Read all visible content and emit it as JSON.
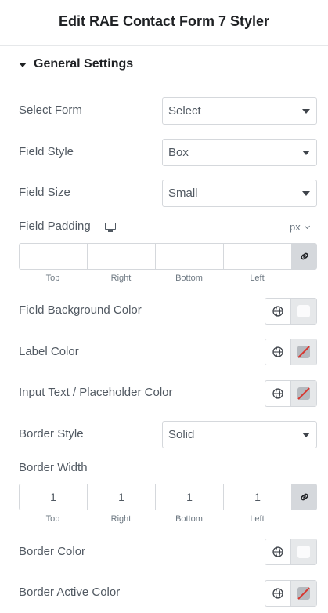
{
  "header": {
    "title": "Edit RAE Contact Form 7 Styler"
  },
  "section": {
    "title": "General Settings"
  },
  "select_form": {
    "label": "Select Form",
    "value": "Select"
  },
  "field_style": {
    "label": "Field Style",
    "value": "Box"
  },
  "field_size": {
    "label": "Field Size",
    "value": "Small"
  },
  "field_padding": {
    "label": "Field Padding",
    "unit": "px",
    "values": [
      "",
      "",
      "",
      ""
    ],
    "sides": [
      "Top",
      "Right",
      "Bottom",
      "Left"
    ]
  },
  "field_bg_color": {
    "label": "Field Background Color",
    "state": "white"
  },
  "label_color": {
    "label": "Label Color",
    "state": "unset"
  },
  "input_text_color": {
    "label": "Input Text / Placeholder Color",
    "state": "unset"
  },
  "border_style": {
    "label": "Border Style",
    "value": "Solid"
  },
  "border_width": {
    "label": "Border Width",
    "values": [
      "1",
      "1",
      "1",
      "1"
    ],
    "sides": [
      "Top",
      "Right",
      "Bottom",
      "Left"
    ]
  },
  "border_color": {
    "label": "Border Color",
    "state": "white"
  },
  "border_active_color": {
    "label": "Border Active Color",
    "state": "unset"
  },
  "colors": {
    "text": "#515962",
    "heading": "#1f2124",
    "border": "#d5d8dc",
    "unset_slash": "#d8352e"
  }
}
